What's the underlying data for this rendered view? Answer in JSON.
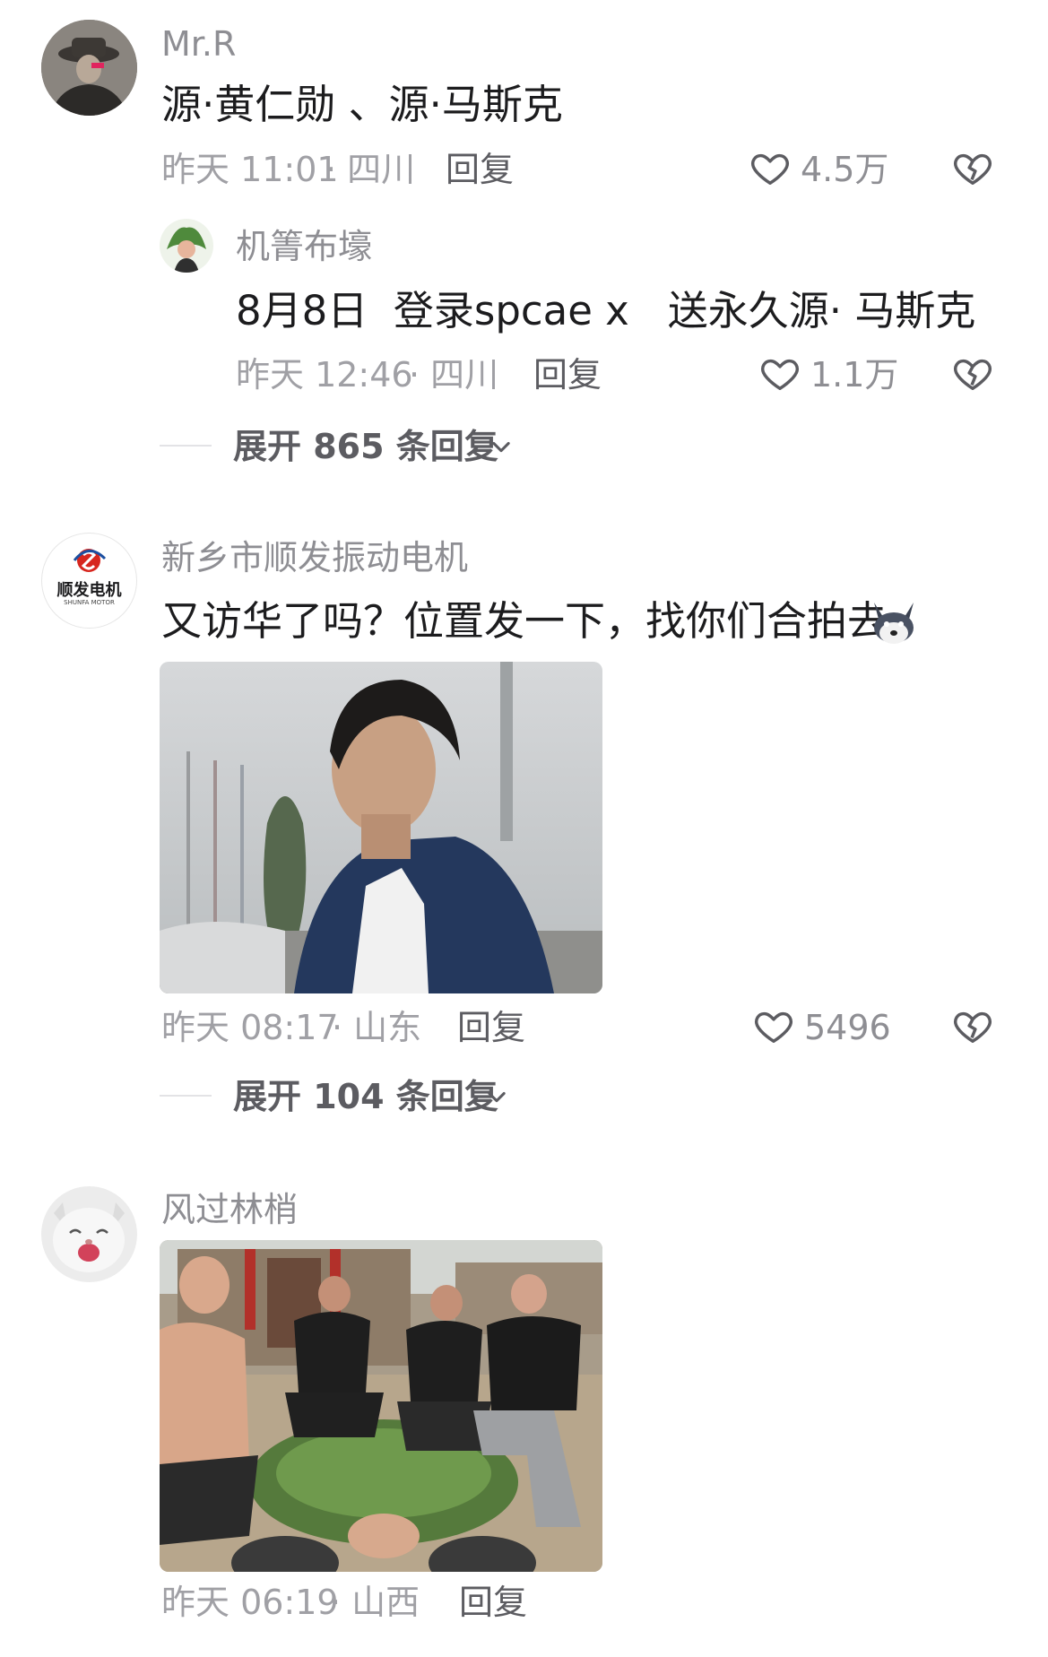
{
  "comments": [
    {
      "author": "Mr.R",
      "text": "源·黄仁勋 、源·马斯克",
      "time": "昨天 11:01",
      "location": "· 四川",
      "reply_label": "回复",
      "likes": "4.5万",
      "replies": [
        {
          "author": "机箐布壕",
          "text": "8月8日  登录spcae x   送永久源· 马斯克",
          "time": "昨天 12:46",
          "location": "· 四川",
          "reply_label": "回复",
          "likes": "1.1万"
        }
      ],
      "expand_label": "展开 865 条回复"
    },
    {
      "author": "新乡市顺发振动电机",
      "avatar_logo_text": "顺发电机",
      "avatar_logo_subtext": "SHUNFA MOTOR",
      "text": "又访华了吗？位置发一下，找你们合拍去",
      "emoji_icon": "husky-emoji",
      "time": "昨天 08:17",
      "location": "· 山东",
      "reply_label": "回复",
      "likes": "5496",
      "expand_label": "展开 104 条回复"
    },
    {
      "author": "风过林梢",
      "time": "昨天 06:19",
      "location": "· 山西",
      "reply_label": "回复"
    }
  ],
  "icons": {
    "like": "heart-outline-icon",
    "dislike": "broken-heart-icon",
    "expand": "chevron-down-icon"
  },
  "colors": {
    "text": "#1c1c1e",
    "secondary": "#8e8e93",
    "background": "#ffffff",
    "logo_red": "#d7261e",
    "logo_blue": "#1c4fa0"
  }
}
